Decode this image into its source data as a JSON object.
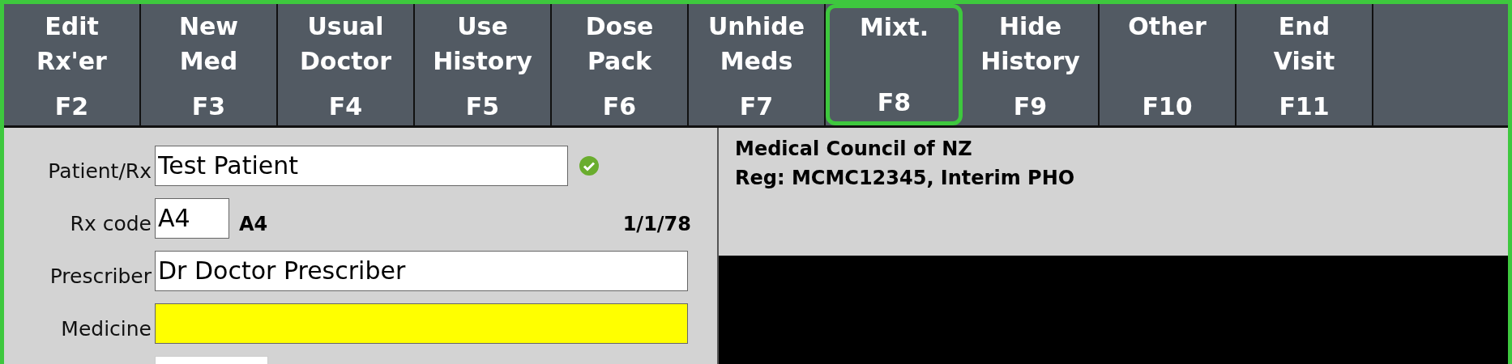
{
  "toolbar": {
    "buttons": [
      {
        "label": "Edit\nRx'er",
        "key": "F2",
        "selected": false
      },
      {
        "label": "New\nMed",
        "key": "F3",
        "selected": false
      },
      {
        "label": "Usual\nDoctor",
        "key": "F4",
        "selected": false
      },
      {
        "label": "Use\nHistory",
        "key": "F5",
        "selected": false
      },
      {
        "label": "Dose\nPack",
        "key": "F6",
        "selected": false
      },
      {
        "label": "Unhide\nMeds",
        "key": "F7",
        "selected": false
      },
      {
        "label": "Mixt.",
        "key": "F8",
        "selected": true
      },
      {
        "label": "Hide\nHistory",
        "key": "F9",
        "selected": false
      },
      {
        "label": "Other",
        "key": "F10",
        "selected": false
      },
      {
        "label": "End\nVisit",
        "key": "F11",
        "selected": false
      }
    ]
  },
  "form": {
    "patient": {
      "label": "Patient/Rx",
      "value": "Test Patient",
      "verified": true
    },
    "rx_code": {
      "label": "Rx code",
      "value": "A4",
      "code_display": "A4",
      "date": "1/1/78"
    },
    "prescriber": {
      "label": "Prescriber",
      "value": "Dr Doctor Prescriber"
    },
    "medicine": {
      "label": "Medicine",
      "focused": true
    }
  },
  "info_panel": {
    "lines": [
      "Medical Council of NZ",
      "Reg: MCMC12345, Interim PHO"
    ]
  }
}
